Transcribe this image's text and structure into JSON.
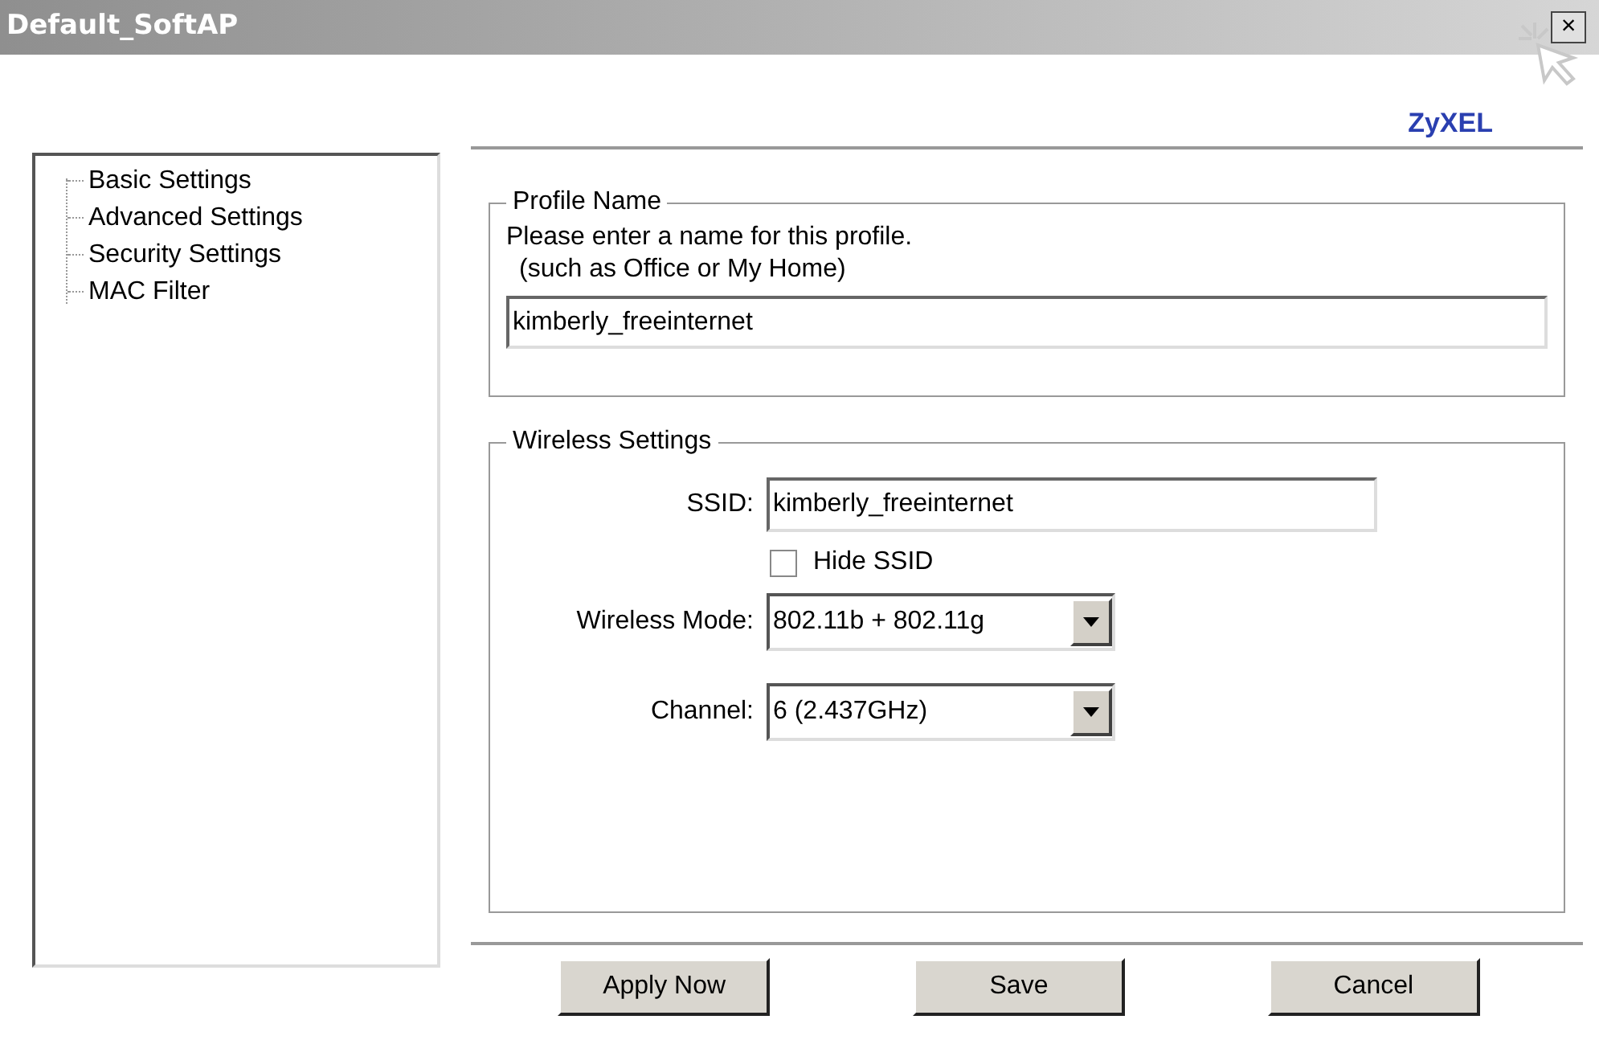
{
  "window": {
    "title": "Default_SoftAP",
    "close": "×"
  },
  "logo": "ZyXEL",
  "tree": [
    {
      "label": "Basic Settings",
      "selected": false
    },
    {
      "label": "Advanced Settings",
      "selected": false
    },
    {
      "label": "Security Settings",
      "selected": false
    },
    {
      "label": "MAC Filter",
      "selected": false
    }
  ],
  "profile": {
    "legend": "Profile Name",
    "hint": "Please enter a name for this profile.",
    "example": "(such as Office or My Home)",
    "value": "kimberly_freeinternet"
  },
  "wireless": {
    "legend": "Wireless Settings",
    "ssid_label": "SSID:",
    "ssid": "kimberly_freeinternet",
    "hide_ssid": {
      "label": "Hide SSID",
      "checked": false
    },
    "mode_label": "Wireless Mode:",
    "mode": "802.11b + 802.11g",
    "channel_label": "Channel:",
    "channel": "6 (2.437GHz)"
  },
  "buttons": [
    "Apply Now",
    "Save",
    "Cancel"
  ]
}
